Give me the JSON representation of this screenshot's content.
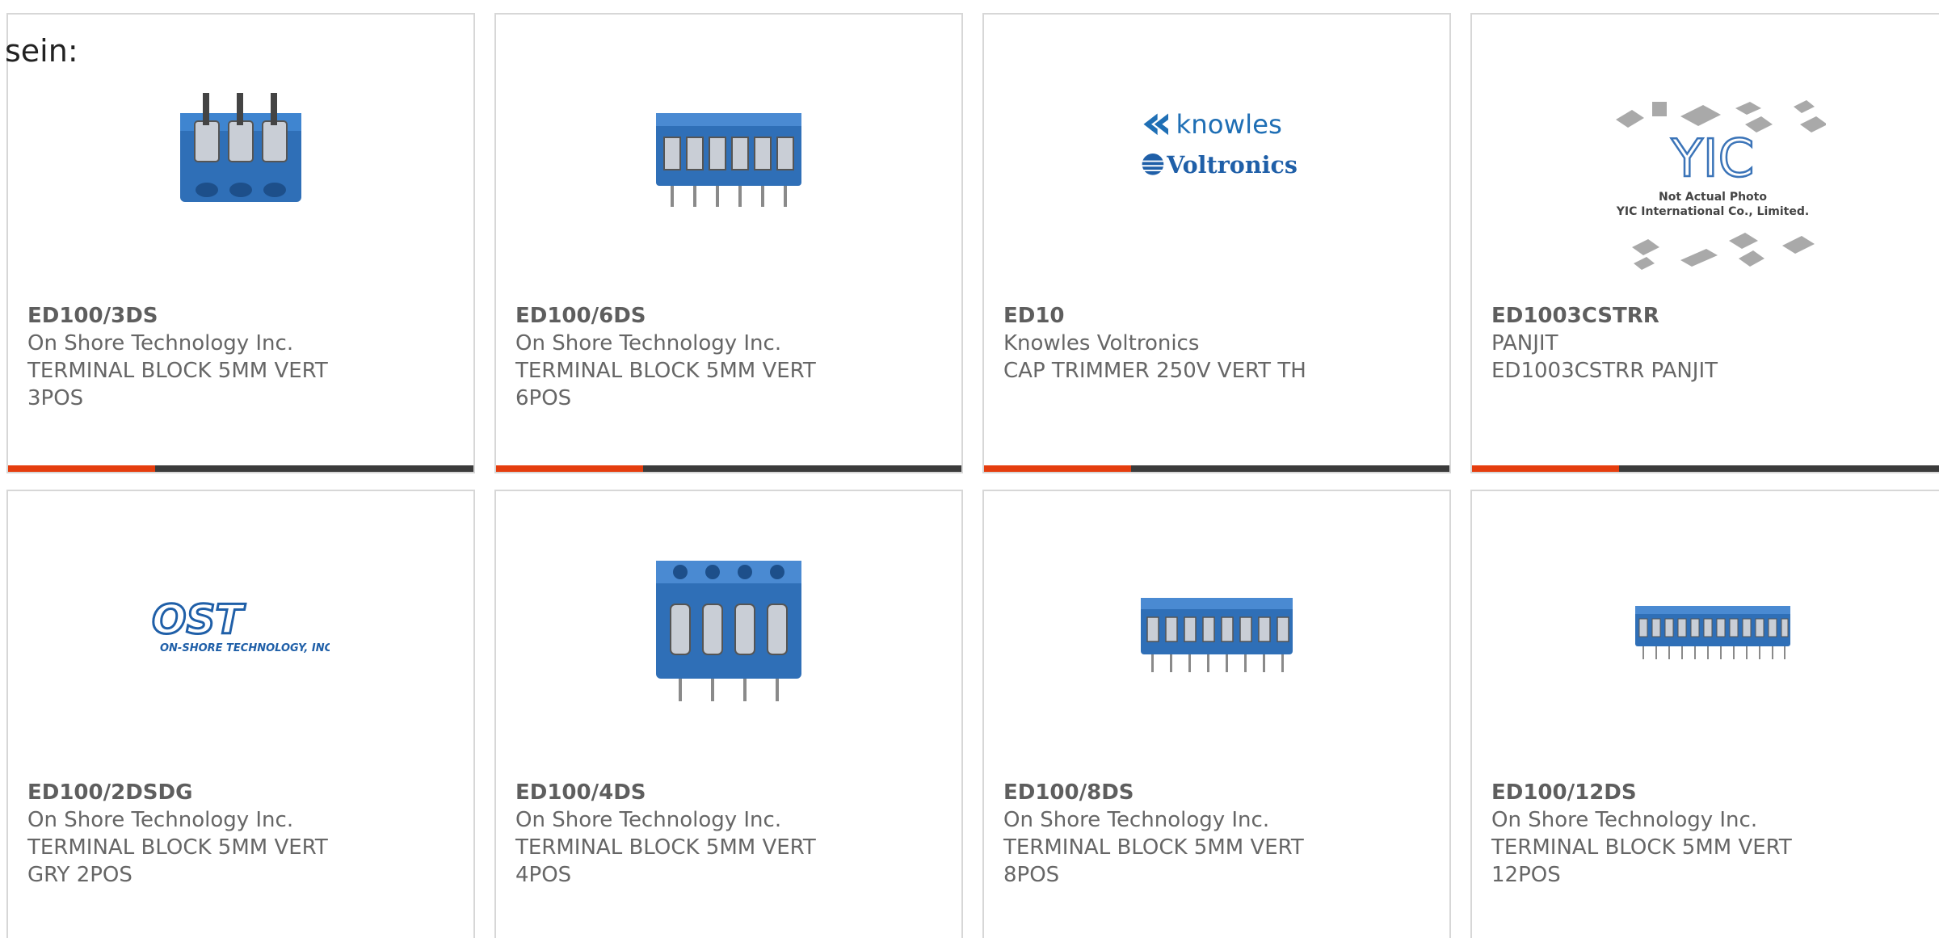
{
  "heading": "sein:",
  "colors": {
    "accent": "#e53d0e",
    "bar": "#3b3b3b",
    "terminal_blue": "#2f6fb7",
    "brand_blue": "#1f5fa8"
  },
  "products": [
    {
      "part": "ED100/3DS",
      "mfr": "On Shore Technology Inc.",
      "desc_line1": "TERMINAL BLOCK 5MM VERT",
      "desc_line2": "3POS",
      "image": "terminal-block-3pos"
    },
    {
      "part": "ED100/6DS",
      "mfr": "On Shore Technology Inc.",
      "desc_line1": "TERMINAL BLOCK 5MM VERT",
      "desc_line2": "6POS",
      "image": "terminal-block-6pos"
    },
    {
      "part": "ED10",
      "mfr": "Knowles Voltronics",
      "desc_line1": "CAP TRIMMER 250V VERT TH",
      "desc_line2": "",
      "image": "knowles-voltronics-logo",
      "logo_line1": "knowles",
      "logo_line2": "Voltronics"
    },
    {
      "part": "ED1003CSTRR",
      "mfr": "PANJIT",
      "desc_line1": "ED1003CSTRR PANJIT",
      "desc_line2": "",
      "image": "yic-placeholder",
      "logo_brand": "YIC",
      "logo_note1": "Not Actual Photo",
      "logo_note2": "YIC International Co., Limited."
    },
    {
      "part": "ED100/2DSDG",
      "mfr": "On Shore Technology Inc.",
      "desc_line1": "TERMINAL BLOCK 5MM VERT",
      "desc_line2": "GRY 2POS",
      "image": "ost-logo",
      "logo_main": "OST",
      "logo_sub": "ON-SHORE TECHNOLOGY, INC."
    },
    {
      "part": "ED100/4DS",
      "mfr": "On Shore Technology Inc.",
      "desc_line1": "TERMINAL BLOCK 5MM VERT",
      "desc_line2": "4POS",
      "image": "terminal-block-4pos"
    },
    {
      "part": "ED100/8DS",
      "mfr": "On Shore Technology Inc.",
      "desc_line1": "TERMINAL BLOCK 5MM VERT",
      "desc_line2": "8POS",
      "image": "terminal-block-8pos"
    },
    {
      "part": "ED100/12DS",
      "mfr": "On Shore Technology Inc.",
      "desc_line1": "TERMINAL BLOCK 5MM VERT",
      "desc_line2": "12POS",
      "image": "terminal-block-12pos"
    }
  ]
}
